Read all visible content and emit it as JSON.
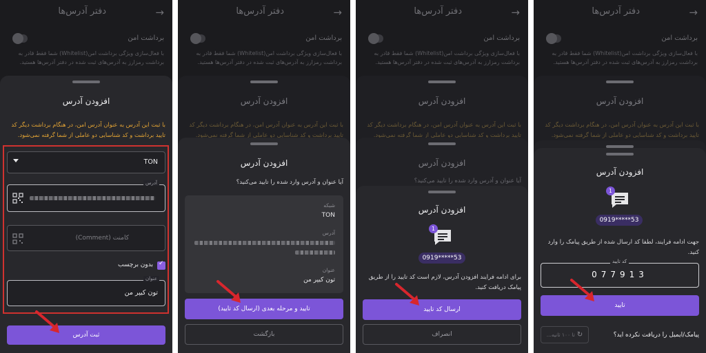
{
  "header": {
    "title": "دفتر آدرس‌ها",
    "back_glyph": "→"
  },
  "safe_withdraw": {
    "label": "برداشت امن",
    "description": "با فعال‌سازی ویژگی برداشت امن(Whitelist) شما فقط قادر به برداشت رمزارز به آدرس‌های ثبت شده در دفتر آدرس‌ها هستید."
  },
  "add_sheet": {
    "title": "افزودن آدرس",
    "warning": "با ثبت این آدرس به عنوان آدرس امن، در هنگام برداشت دیگر کد تایید برداشت و کد شناسایی دو عاملی از شما گرفته نمی‌شود."
  },
  "form": {
    "network_value": "TON",
    "address_label": "آدرس",
    "comment_placeholder": "کامنت (Comment)",
    "no_tag_label": "بدون برچسب",
    "title_label": "عنوان",
    "title_value": "تون کیپر من",
    "submit_label": "ثبت آدرس"
  },
  "confirm": {
    "title": "افزودن آدرس",
    "question": "آیا عنوان و آدرس وارد شده را تایید می‌کنید؟",
    "network_key": "شبکه",
    "network_value": "TON",
    "address_key": "آدرس",
    "title_key": "عنوان",
    "title_value": "تون کیپر من",
    "next_label": "تایید و مرحله بعدی (ارسال کد تایید)",
    "back_label": "بازگشت"
  },
  "send_code": {
    "title": "افزودن آدرس",
    "badge": "1",
    "phone": "0919*****53",
    "message": "برای ادامه فرایند افزودن آدرس، لازم است کد تایید را از طریق پیامک دریافت کنید.",
    "send_label": "ارسال کد تایید",
    "cancel_label": "انصراف"
  },
  "verify": {
    "title": "افزودن آدرس",
    "badge": "1",
    "phone": "0919*****53",
    "instruction": "جهت ادامه فرایند، لطفا کد ارسال شده از طریق پیامک را وارد کنید.",
    "code_label": "کد تایید",
    "code_value": "077913",
    "confirm_label": "تایید",
    "timer_label": "تا ۱۰۰ ثانیه...",
    "not_received": "پیامک/ایمیل را دریافت نکرده اید؟"
  },
  "colors": {
    "accent": "#7c55d8",
    "warning": "#e3a435",
    "highlight": "#d0322f",
    "background": "#1b1b1e",
    "sheet": "#28282c"
  }
}
